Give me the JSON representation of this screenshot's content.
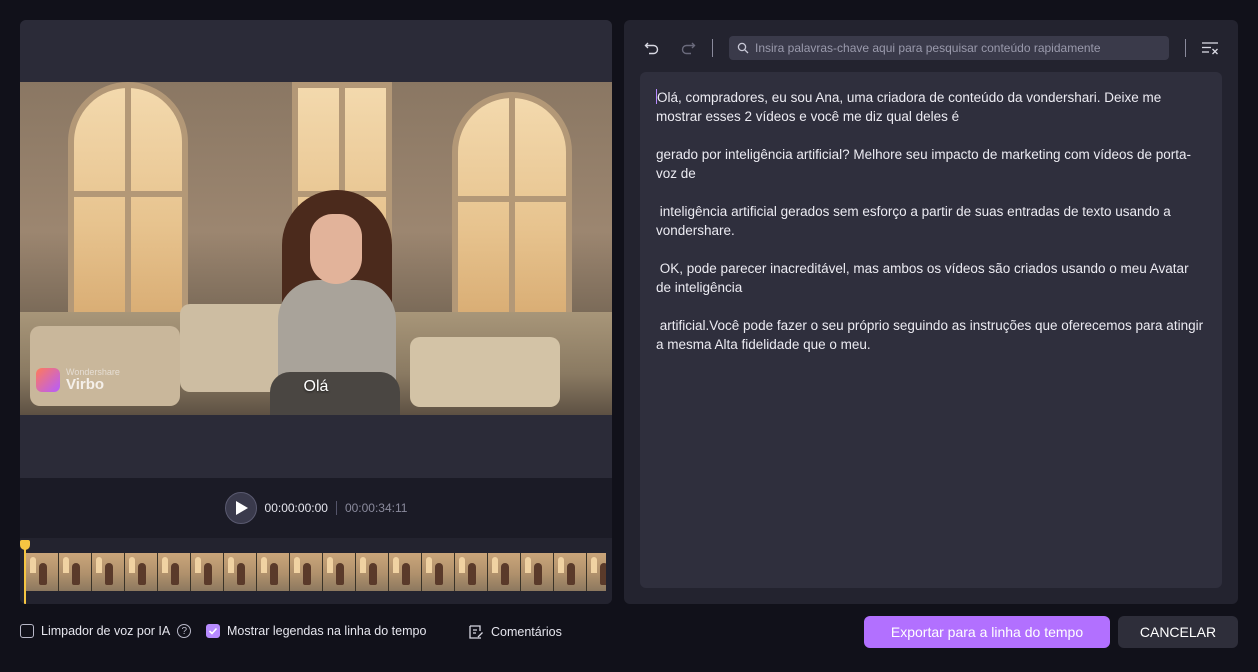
{
  "preview": {
    "watermark": {
      "brand_small": "Wondershare",
      "brand_big": "Virbo"
    },
    "subtitle": "Olá",
    "controls": {
      "current_time": "00:00:00:00",
      "total_time": "00:00:34:11",
      "play_icon": "play-icon"
    },
    "timeline": {
      "thumbnail_count": 18,
      "playhead_color": "#f5c542"
    }
  },
  "editor": {
    "toolbar": {
      "undo_icon": "undo-icon",
      "redo_icon": "redo-icon",
      "search_placeholder": "Insira palavras-chave aqui para pesquisar conteúdo rapidamente",
      "filter_icon": "filter-clear-icon"
    },
    "paragraphs": [
      "Olá, compradores, eu sou Ana, uma criadora de conteúdo da vondershari. Deixe me mostrar esses 2 vídeos e você me diz qual deles é",
      "gerado por inteligência artificial? Melhore seu impacto de marketing com vídeos de porta-voz de",
      " inteligência artificial gerados sem esforço a partir de suas entradas de texto usando a vondershare.",
      " OK, pode parecer inacreditável, mas ambos os vídeos são criados usando o meu Avatar de inteligência",
      " artificial.Você pode fazer o seu próprio seguindo as instruções que oferecemos para atingir a mesma Alta fidelidade que o meu."
    ]
  },
  "bottom": {
    "voice_cleaner_label": "Limpador de voz por IA",
    "voice_cleaner_checked": false,
    "show_subtitles_label": "Mostrar legendas na linha do tempo",
    "show_subtitles_checked": true,
    "comments_label": "Comentários",
    "export_button": "Exportar para a linha do tempo",
    "cancel_button": "CANCELAR"
  },
  "colors": {
    "accent": "#b270ff",
    "background": "#11111a",
    "panel": "#23232f"
  }
}
